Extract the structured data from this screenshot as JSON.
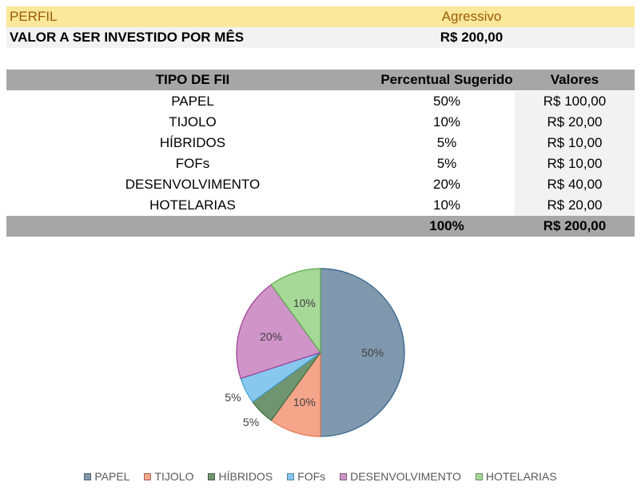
{
  "perfil": {
    "label": "PERFIL",
    "value": "Agressivo"
  },
  "valor_mes": {
    "label": "VALOR A SER INVESTIDO POR MÊS",
    "value": "R$ 200,00"
  },
  "table": {
    "headers": [
      "TIPO DE FII",
      "Percentual Sugerido",
      "Valores"
    ],
    "rows": [
      {
        "tipo": "PAPEL",
        "pct": "50%",
        "valor": "R$ 100,00"
      },
      {
        "tipo": "TIJOLO",
        "pct": "10%",
        "valor": "R$ 20,00"
      },
      {
        "tipo": "HÍBRIDOS",
        "pct": "5%",
        "valor": "R$ 10,00"
      },
      {
        "tipo": "FOFs",
        "pct": "5%",
        "valor": "R$ 10,00"
      },
      {
        "tipo": "DESENVOLVIMENTO",
        "pct": "20%",
        "valor": "R$ 40,00"
      },
      {
        "tipo": "HOTELARIAS",
        "pct": "10%",
        "valor": "R$ 20,00"
      }
    ],
    "total": {
      "tipo": "",
      "pct": "100%",
      "valor": "R$ 200,00"
    }
  },
  "chart_data": {
    "type": "pie",
    "title": "",
    "categories": [
      "PAPEL",
      "TIJOLO",
      "HÍBRIDOS",
      "FOFs",
      "DESENVOLVIMENTO",
      "HOTELARIAS"
    ],
    "values": [
      50,
      10,
      5,
      5,
      20,
      10
    ],
    "labels": [
      "50%",
      "10%",
      "5%",
      "5%",
      "20%",
      "10%"
    ],
    "colors": [
      "#7f98ad",
      "#f4a58a",
      "#6f9470",
      "#88c8ee",
      "#cf94c8",
      "#a6d897"
    ],
    "stroke_colors": [
      "#2f5f8a",
      "#e0774f",
      "#3c6b3c",
      "#3d9fd6",
      "#9b3c95",
      "#5aa84a"
    ],
    "legend_position": "bottom"
  }
}
